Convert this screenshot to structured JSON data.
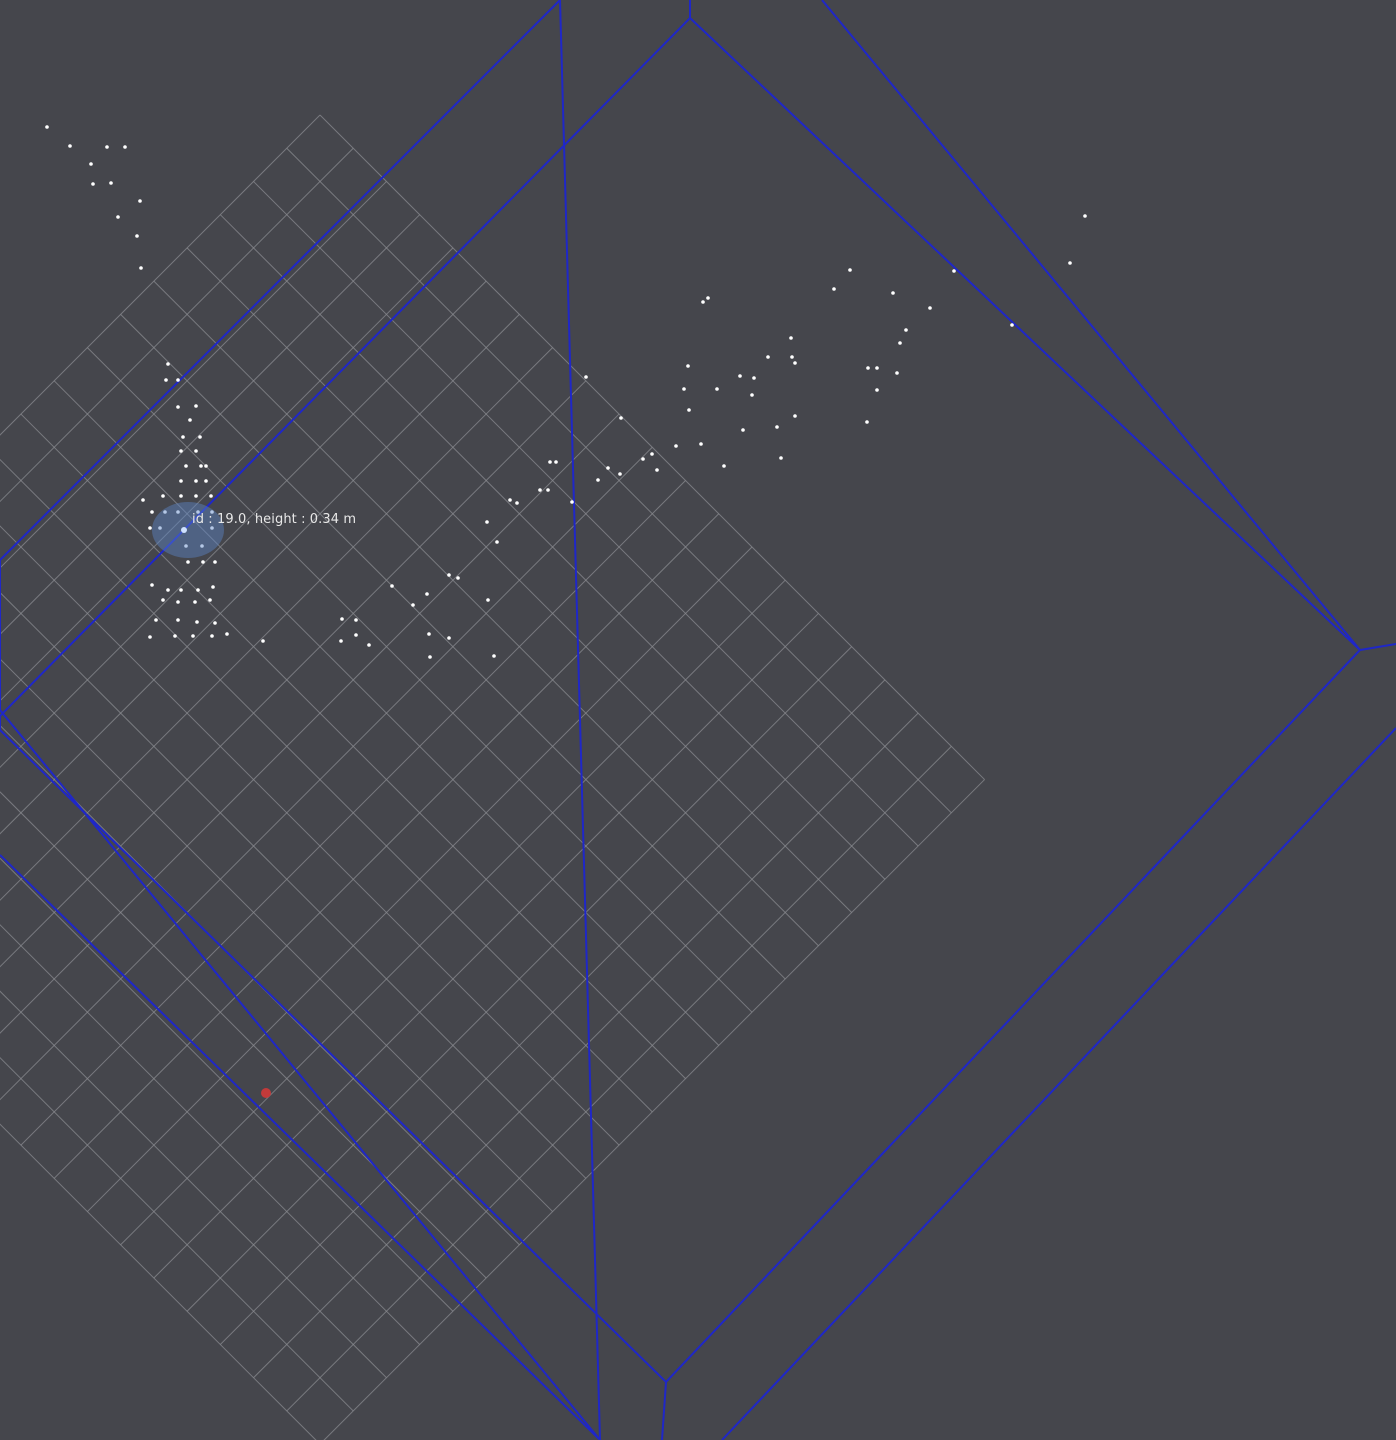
{
  "viewer": {
    "tooltip": "id : 19.0, height : 0.34 m"
  },
  "colors": {
    "background": "#45464c",
    "grid": "#8a8b90",
    "zone_boundary": "#1f27c8",
    "points": "#ffffff",
    "selected_highlight": "#5a84c8",
    "origin_marker": "#c23a3a"
  }
}
